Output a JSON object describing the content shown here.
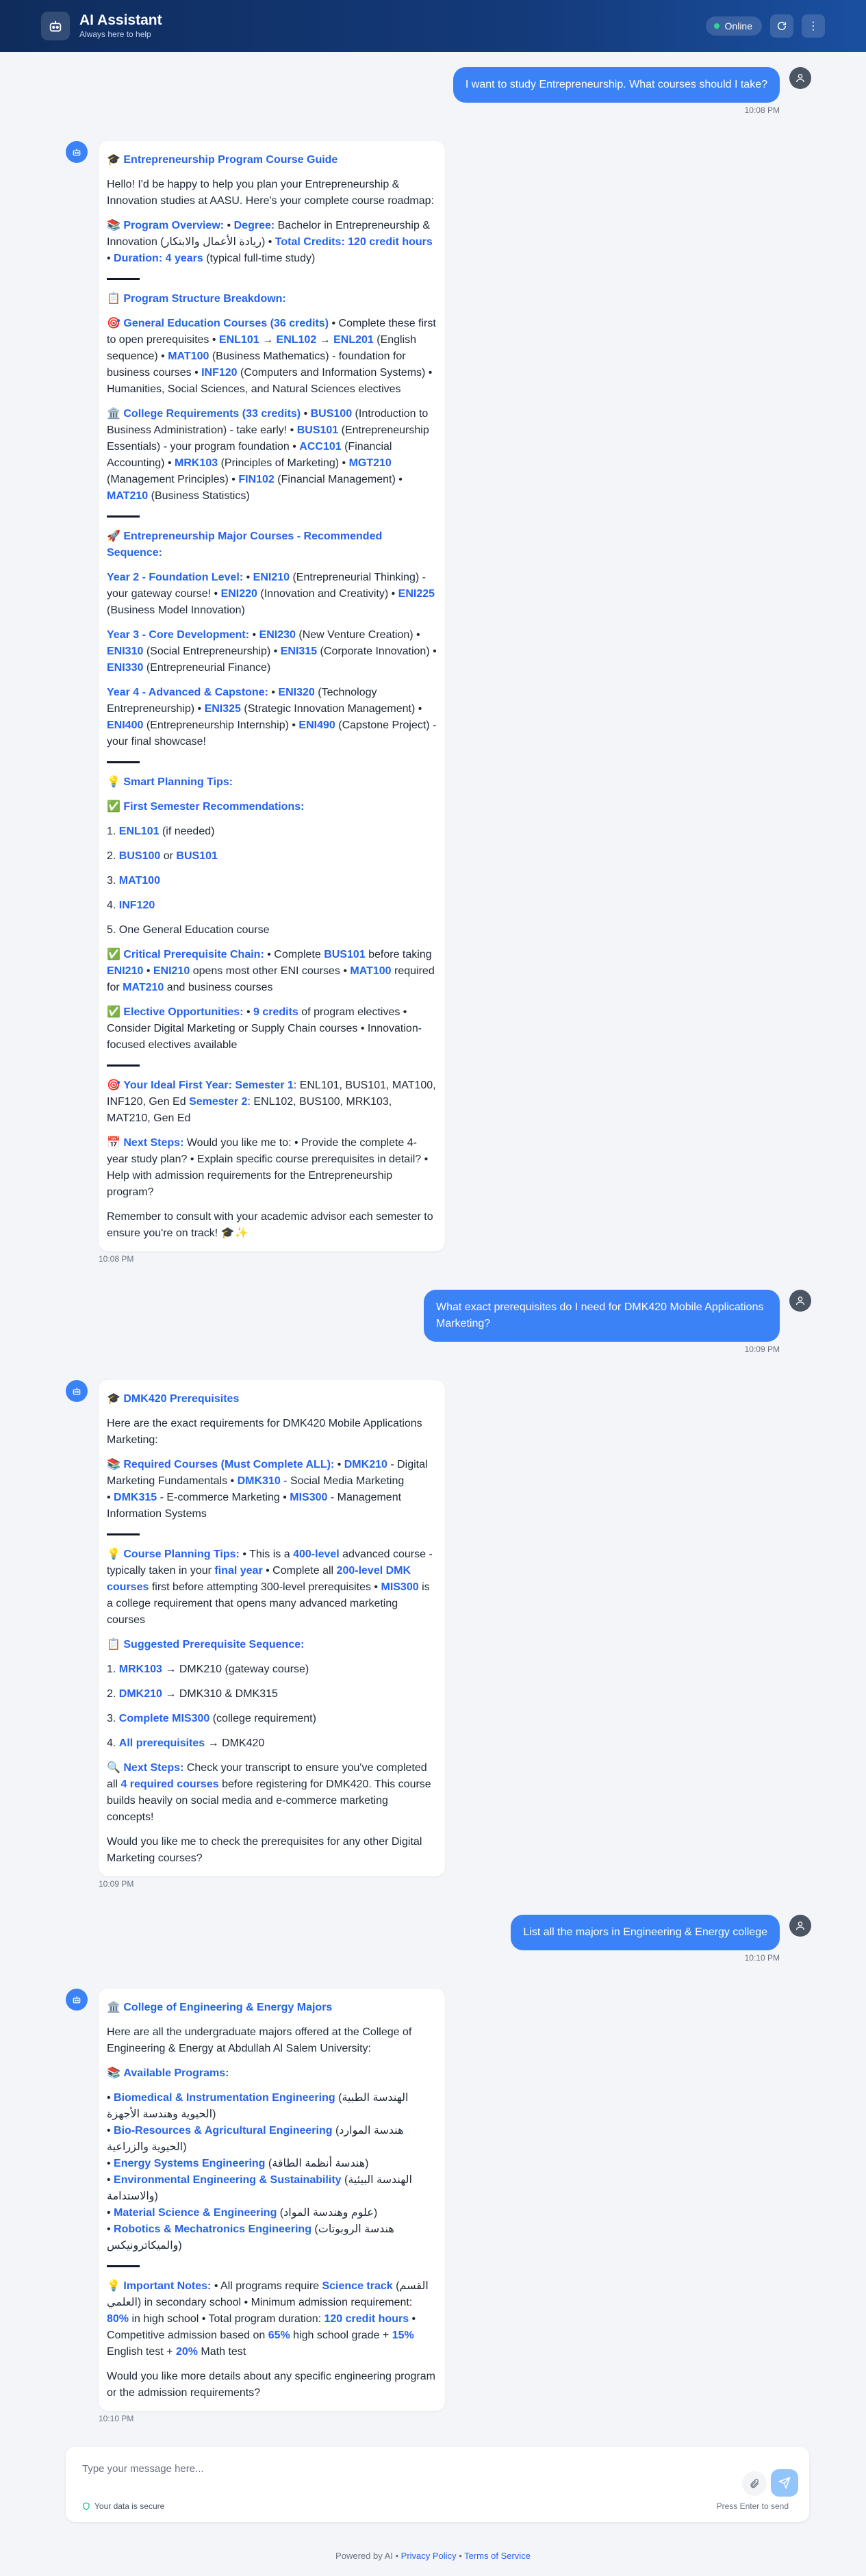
{
  "header": {
    "title": "AI Assistant",
    "subtitle": "Always here to help",
    "status": "Online"
  },
  "messages": [
    {
      "role": "user",
      "text": "I want to study Entrepreneurship. What courses should I take?",
      "time": "10:08 PM"
    },
    {
      "role": "bot",
      "time": "10:08 PM",
      "blocks": [
        [
          "🎓 ",
          {
            "t": "Entrepreneurship Program Course Guide",
            "s": "b"
          }
        ],
        [
          "Hello! I'd be happy to help you plan your Entrepreneurship & Innovation studies at AASU. Here's your complete course roadmap:"
        ],
        [
          "📚 ",
          {
            "t": "Program Overview:",
            "s": "b"
          },
          " • ",
          {
            "t": "Degree:",
            "s": "b"
          },
          " Bachelor in Entrepreneurship & Innovation (ريادة الأعمال والابتكار) • ",
          {
            "t": "Total Credits: 120 credit hours",
            "s": "b"
          },
          " • ",
          {
            "t": "Duration: 4 years",
            "s": "b"
          },
          " (typical full-time study)"
        ],
        "rule",
        [
          "📋 ",
          {
            "t": "Program Structure Breakdown:",
            "s": "b"
          }
        ],
        [
          "🎯 ",
          {
            "t": "General Education Courses (36 credits)",
            "s": "b"
          },
          " • Complete these first to open prerequisites • ",
          {
            "t": "ENL101",
            "s": "b"
          },
          " → ",
          {
            "t": "ENL102",
            "s": "b"
          },
          " → ",
          {
            "t": "ENL201",
            "s": "b"
          },
          " (English sequence) • ",
          {
            "t": "MAT100",
            "s": "b"
          },
          " (Business Mathematics) - foundation for business courses • ",
          {
            "t": "INF120",
            "s": "b"
          },
          " (Computers and Information Systems) • Humanities, Social Sciences, and Natural Sciences electives"
        ],
        [
          "🏛️ ",
          {
            "t": "College Requirements (33 credits)",
            "s": "b"
          },
          " • ",
          {
            "t": "BUS100",
            "s": "b"
          },
          " (Introduction to Business Administration) - take early! • ",
          {
            "t": "BUS101",
            "s": "b"
          },
          " (Entrepreneurship Essentials) - your program foundation • ",
          {
            "t": "ACC101",
            "s": "b"
          },
          " (Financial Accounting) • ",
          {
            "t": "MRK103",
            "s": "b"
          },
          " (Principles of Marketing) • ",
          {
            "t": "MGT210",
            "s": "b"
          },
          " (Management Principles) • ",
          {
            "t": "FIN102",
            "s": "b"
          },
          " (Financial Management) • ",
          {
            "t": "MAT210",
            "s": "b"
          },
          " (Business Statistics)"
        ],
        "rule",
        [
          "🚀 ",
          {
            "t": "Entrepreneurship Major Courses - Recommended Sequence:",
            "s": "b"
          }
        ],
        [
          {
            "t": "Year 2 - Foundation Level:",
            "s": "b"
          },
          " • ",
          {
            "t": "ENI210",
            "s": "b"
          },
          " (Entrepreneurial Thinking) - your gateway course! • ",
          {
            "t": "ENI220",
            "s": "b"
          },
          " (Innovation and Creativity) • ",
          {
            "t": "ENI225",
            "s": "b"
          },
          " (Business Model Innovation)"
        ],
        [
          {
            "t": "Year 3 - Core Development:",
            "s": "b"
          },
          " • ",
          {
            "t": "ENI230",
            "s": "b"
          },
          " (New Venture Creation) • ",
          {
            "t": "ENI310",
            "s": "b"
          },
          " (Social Entrepreneurship) • ",
          {
            "t": "ENI315",
            "s": "b"
          },
          " (Corporate Innovation) • ",
          {
            "t": "ENI330",
            "s": "b"
          },
          " (Entrepreneurial Finance)"
        ],
        [
          {
            "t": "Year 4 - Advanced & Capstone:",
            "s": "b"
          },
          " • ",
          {
            "t": "ENI320",
            "s": "b"
          },
          " (Technology Entrepreneurship) • ",
          {
            "t": "ENI325",
            "s": "b"
          },
          " (Strategic Innovation Management) • ",
          {
            "t": "ENI400",
            "s": "b"
          },
          " (Entrepreneurship Internship) • ",
          {
            "t": "ENI490",
            "s": "b"
          },
          " (Capstone Project) - your final showcase!"
        ],
        "rule",
        [
          "💡 ",
          {
            "t": "Smart Planning Tips:",
            "s": "b"
          }
        ],
        [
          "✅ ",
          {
            "t": "First Semester Recommendations:",
            "s": "b"
          }
        ],
        [
          "1. ",
          {
            "t": "ENL101",
            "s": "b"
          },
          " (if needed)"
        ],
        [
          "2. ",
          {
            "t": "BUS100",
            "s": "b"
          },
          " or ",
          {
            "t": "BUS101",
            "s": "b"
          }
        ],
        [
          "3. ",
          {
            "t": "MAT100",
            "s": "b"
          }
        ],
        [
          "4. ",
          {
            "t": "INF120",
            "s": "b"
          }
        ],
        [
          "5. One General Education course"
        ],
        [
          "✅ ",
          {
            "t": "Critical Prerequisite Chain:",
            "s": "b"
          },
          " • Complete ",
          {
            "t": "BUS101",
            "s": "b"
          },
          " before taking ",
          {
            "t": "ENI210",
            "s": "b"
          },
          " • ",
          {
            "t": "ENI210",
            "s": "b"
          },
          " opens most other ENI courses • ",
          {
            "t": "MAT100",
            "s": "b"
          },
          " required for ",
          {
            "t": "MAT210",
            "s": "b"
          },
          " and business courses"
        ],
        [
          "✅ ",
          {
            "t": "Elective Opportunities:",
            "s": "b"
          },
          " • ",
          {
            "t": "9 credits",
            "s": "b"
          },
          " of program electives • Consider Digital Marketing or Supply Chain courses • Innovation-focused electives available"
        ],
        "rule",
        [
          "🎯 ",
          {
            "t": "Your Ideal First Year:",
            "s": "b"
          },
          " ",
          {
            "t": "Semester 1",
            "s": "b"
          },
          ": ENL101, BUS101, MAT100, INF120, Gen Ed ",
          {
            "t": "Semester 2",
            "s": "b"
          },
          ": ENL102, BUS100, MRK103, MAT210, Gen Ed"
        ],
        [
          "📅 ",
          {
            "t": "Next Steps:",
            "s": "b"
          },
          " Would you like me to: • Provide the complete 4-year study plan? • Explain specific course prerequisites in detail? • Help with admission requirements for the Entrepreneurship program?"
        ],
        [
          "Remember to consult with your academic advisor each semester to ensure you're on track! 🎓✨"
        ]
      ]
    },
    {
      "role": "user",
      "text": "What exact prerequisites do I need for DMK420 Mobile Applications Marketing?",
      "time": "10:09 PM"
    },
    {
      "role": "bot",
      "time": "10:09 PM",
      "blocks": [
        [
          "🎓 ",
          {
            "t": "DMK420 Prerequisites",
            "s": "b"
          }
        ],
        [
          "Here are the exact requirements for DMK420 Mobile Applications Marketing:"
        ],
        [
          "📚 ",
          {
            "t": "Required Courses (Must Complete ALL):",
            "s": "b"
          },
          " • ",
          {
            "t": "DMK210",
            "s": "b"
          },
          " - Digital Marketing Fundamentals • ",
          {
            "t": "DMK310",
            "s": "b"
          },
          " - Social Media Marketing\n• ",
          {
            "t": "DMK315",
            "s": "b"
          },
          " - E-commerce Marketing • ",
          {
            "t": "MIS300",
            "s": "b"
          },
          " - Management Information Systems"
        ],
        "rule",
        [
          "💡 ",
          {
            "t": "Course Planning Tips:",
            "s": "b"
          },
          " • This is a ",
          {
            "t": "400-level",
            "s": "b"
          },
          " advanced course - typically taken in your ",
          {
            "t": "final year",
            "s": "b"
          },
          " • Complete all ",
          {
            "t": "200-level DMK courses",
            "s": "b"
          },
          " first before attempting 300-level prerequisites • ",
          {
            "t": "MIS300",
            "s": "b"
          },
          " is a college requirement that opens many advanced marketing courses"
        ],
        [
          "📋 ",
          {
            "t": "Suggested Prerequisite Sequence:",
            "s": "b"
          }
        ],
        [
          "1. ",
          {
            "t": "MRK103",
            "s": "b"
          },
          " → DMK210 (gateway course)"
        ],
        [
          "2. ",
          {
            "t": "DMK210",
            "s": "b"
          },
          " → DMK310 & DMK315"
        ],
        [
          "3. ",
          {
            "t": "Complete MIS300",
            "s": "b"
          },
          " (college requirement)"
        ],
        [
          "4. ",
          {
            "t": "All prerequisites",
            "s": "b"
          },
          " → DMK420"
        ],
        [
          "🔍 ",
          {
            "t": "Next Steps:",
            "s": "b"
          },
          " Check your transcript to ensure you've completed all ",
          {
            "t": "4 required courses",
            "s": "b"
          },
          " before registering for DMK420. This course builds heavily on social media and e-commerce marketing concepts!"
        ],
        [
          "Would you like me to check the prerequisites for any other Digital Marketing courses?"
        ]
      ]
    },
    {
      "role": "user",
      "text": "List all the majors in Engineering & Energy college",
      "time": "10:10 PM"
    },
    {
      "role": "bot",
      "time": "10:10 PM",
      "blocks": [
        [
          "🏛️ ",
          {
            "t": "College of Engineering & Energy Majors",
            "s": "b"
          }
        ],
        [
          "Here are all the undergraduate majors offered at the College of Engineering & Energy at Abdullah Al Salem University:"
        ],
        [
          "📚 ",
          {
            "t": "Available Programs:",
            "s": "b"
          }
        ],
        [
          "• ",
          {
            "t": "Biomedical & Instrumentation Engineering",
            "s": "b"
          },
          " (الهندسة الطبية الحيوية وهندسة الأجهزة)\n• ",
          {
            "t": "Bio-Resources & Agricultural Engineering",
            "s": "b"
          },
          " (هندسة الموارد الحيوية والزراعية)\n• ",
          {
            "t": "Energy Systems Engineering",
            "s": "b"
          },
          " (هندسة أنظمة الطاقة)\n• ",
          {
            "t": "Environmental Engineering & Sustainability",
            "s": "b"
          },
          " (الهندسة البيئية والاستدامة)\n• ",
          {
            "t": "Material Science & Engineering",
            "s": "b"
          },
          " (علوم وهندسة المواد)\n• ",
          {
            "t": "Robotics & Mechatronics Engineering",
            "s": "b"
          },
          " (هندسة الروبوتات والميكاترونيكس)"
        ],
        "rule",
        [
          "💡 ",
          {
            "t": "Important Notes:",
            "s": "b"
          },
          " • All programs require ",
          {
            "t": "Science track",
            "s": "b"
          },
          " (القسم العلمي) in secondary school • Minimum admission requirement: ",
          {
            "t": "80%",
            "s": "b"
          },
          " in high school • Total program duration: ",
          {
            "t": "120 credit hours",
            "s": "b"
          },
          " • Competitive admission based on ",
          {
            "t": "65%",
            "s": "b"
          },
          " high school grade + ",
          {
            "t": "15%",
            "s": "b"
          },
          " English test + ",
          {
            "t": "20%",
            "s": "b"
          },
          " Math test"
        ],
        [
          "Would you like more details about any specific engineering program or the admission requirements?"
        ]
      ]
    }
  ],
  "composer": {
    "placeholder": "Type your message here...",
    "secure_text": "Your data is secure",
    "enter_hint": "Press Enter to send"
  },
  "footer": {
    "prefix": "Powered by AI • ",
    "privacy": "Privacy Policy",
    "sep": " • ",
    "terms": "Terms of Service"
  }
}
